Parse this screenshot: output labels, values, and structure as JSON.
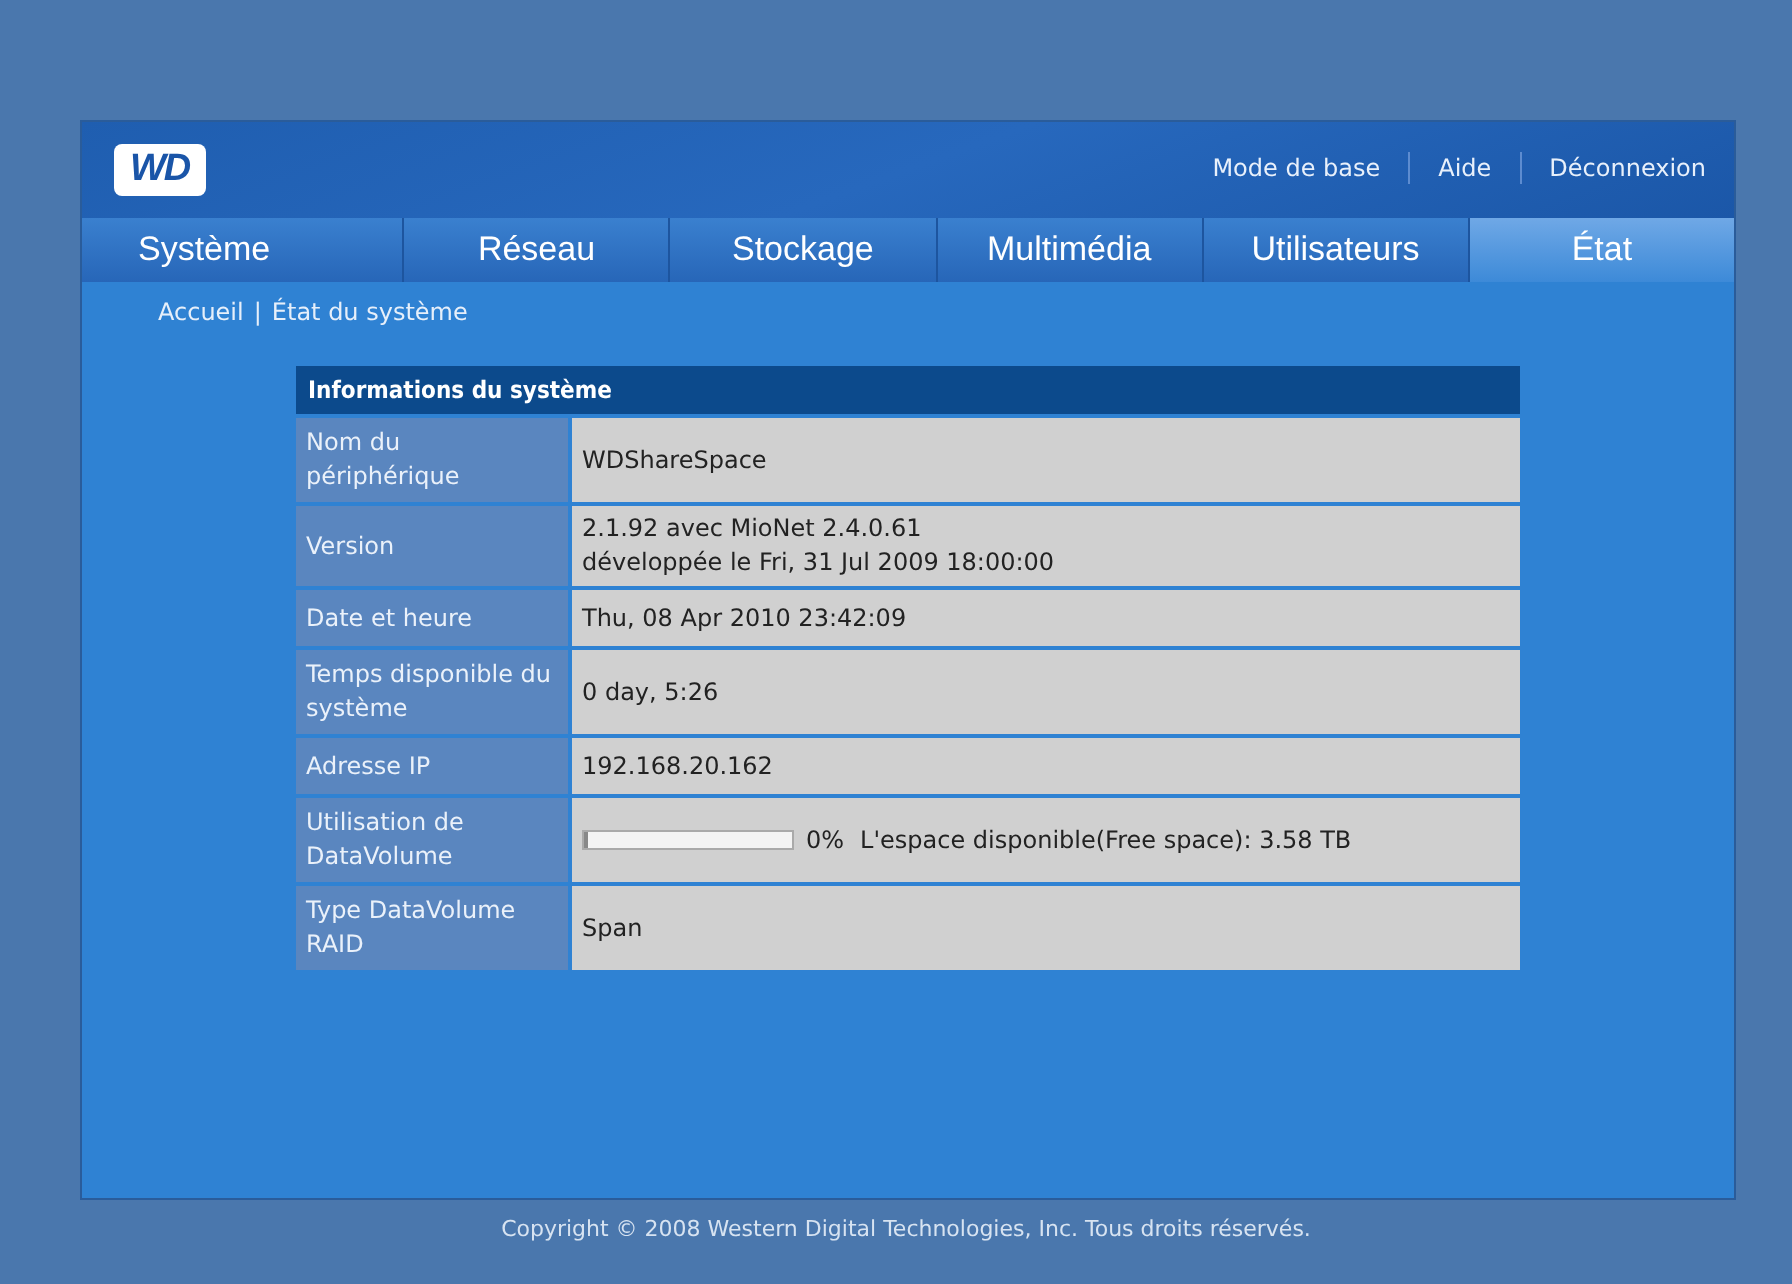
{
  "logo": "WD",
  "top_links": [
    "Mode de base",
    "Aide",
    "Déconnexion"
  ],
  "tabs": [
    {
      "label": "Système",
      "selected": false
    },
    {
      "label": "Réseau",
      "selected": false
    },
    {
      "label": "Stockage",
      "selected": false
    },
    {
      "label": "Multimédia",
      "selected": false
    },
    {
      "label": "Utilisateurs",
      "selected": false
    },
    {
      "label": "État",
      "selected": true
    }
  ],
  "breadcrumb": {
    "home": "Accueil",
    "separator": "|",
    "current": "État du système"
  },
  "table": {
    "title": "Informations du système",
    "rows": [
      {
        "kind": "text",
        "label": "Nom du périphérique",
        "lines": [
          "WDShareSpace"
        ]
      },
      {
        "kind": "text",
        "label": "Version",
        "lines": [
          "2.1.92 avec MioNet 2.4.0.61",
          "développée le Fri, 31 Jul 2009 18:00:00"
        ]
      },
      {
        "kind": "text",
        "label": "Date et heure",
        "lines": [
          "Thu, 08 Apr 2010 23:42:09"
        ]
      },
      {
        "kind": "text",
        "label": "Temps disponible du système",
        "lines": [
          "0 day, 5:26"
        ]
      },
      {
        "kind": "text",
        "label": "Adresse IP",
        "lines": [
          "192.168.20.162"
        ]
      },
      {
        "kind": "usage",
        "label": "Utilisation de DataVolume",
        "level": 0,
        "percent": "0%",
        "free": "L'espace disponible(Free space): 3.58 TB"
      },
      {
        "kind": "text",
        "label": "Type DataVolume RAID",
        "lines": [
          "Span"
        ]
      }
    ]
  },
  "footer": "Copyright © 2008 Western Digital Technologies, Inc. Tous droits réservés."
}
